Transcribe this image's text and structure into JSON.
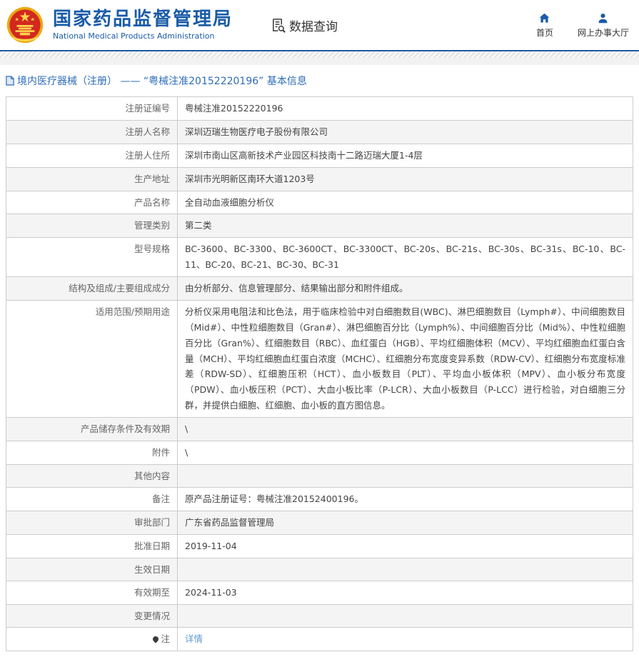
{
  "header": {
    "title_zh": "国家药品监督管理局",
    "title_en": "National Medical Products Administration",
    "nav": {
      "data_query": "数据查询",
      "home": "首页",
      "service_hall": "网上办事大厅"
    }
  },
  "breadcrumb": {
    "text": "境内医疗器械（注册） —— “粤械注准20152220196” 基本信息"
  },
  "colors": {
    "brand_blue": "#1a5ca8",
    "breadcrumb_blue": "#2e6cb8",
    "link_blue": "#5b9bd5",
    "row_alt_bg": "#f4f4f4",
    "border": "#cccccc"
  },
  "table": {
    "rows": [
      {
        "label": "注册证编号",
        "value": "粤械注准20152220196"
      },
      {
        "label": "注册人名称",
        "value": "深圳迈瑞生物医疗电子股份有限公司"
      },
      {
        "label": "注册人住所",
        "value": "深圳市南山区高新技术产业园区科技南十二路迈瑞大厦1-4层"
      },
      {
        "label": "生产地址",
        "value": "深圳市光明新区南环大道1203号"
      },
      {
        "label": "产品名称",
        "value": "全自动血液细胞分析仪"
      },
      {
        "label": "管理类别",
        "value": "第二类"
      },
      {
        "label": "型号规格",
        "value": "BC-3600、BC-3300、BC-3600CT、BC-3300CT、BC-20s、BC-21s、BC-30s、BC-31s、BC-10、BC-11、BC-20、BC-21、BC-30、BC-31"
      },
      {
        "label": "结构及组成/主要组成成分",
        "value": "由分析部分、信息管理部分、结果输出部分和附件组成。"
      },
      {
        "label": "适用范围/预期用途",
        "value": "分析仪采用电阻法和比色法，用于临床检验中对白细胞数目(WBC)、淋巴细胞数目（Lymph#）、中间细胞数目（Mid#）、中性粒细胞数目（Gran#）、淋巴细胞百分比（Lymph%）、中间细胞百分比（Mid%）、中性粒细胞百分比（Gran%）、红细胞数目（RBC）、血红蛋白（HGB）、平均红细胞体积（MCV）、平均红细胞血红蛋白含量（MCH）、平均红细胞血红蛋白浓度（MCHC）、红细胞分布宽度变异系数（RDW-CV）、红细胞分布宽度标准差（RDW-SD）、红细胞压积（HCT）、血小板数目（PLT）、平均血小板体积（MPV）、血小板分布宽度（PDW）、血小板压积（PCT）、大血小板比率（P-LCR）、大血小板数目（P-LCC）进行检验，对白细胞三分群，并提供白细胞、红细胞、血小板的直方图信息。"
      },
      {
        "label": "产品储存条件及有效期",
        "value": "\\"
      },
      {
        "label": "附件",
        "value": "\\"
      },
      {
        "label": "其他内容",
        "value": ""
      },
      {
        "label": "备注",
        "value": "原产品注册证号：粤械注准20152400196。"
      },
      {
        "label": "审批部门",
        "value": "广东省药品监督管理局"
      },
      {
        "label": "批准日期",
        "value": "2019-11-04"
      },
      {
        "label": "生效日期",
        "value": ""
      },
      {
        "label": "有效期至",
        "value": "2024-11-03"
      },
      {
        "label": "变更情况",
        "value": ""
      },
      {
        "label": "注",
        "label_icon": "pin-icon",
        "value": "详情",
        "value_is_link": true
      }
    ]
  }
}
